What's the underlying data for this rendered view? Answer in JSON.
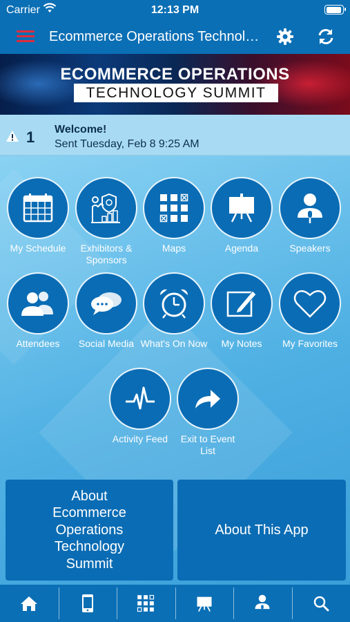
{
  "status_bar": {
    "carrier": "Carrier",
    "time": "12:13 PM"
  },
  "nav": {
    "title": "Ecommerce Operations Technolo…"
  },
  "banner": {
    "line1": "ECOMMERCE OPERATIONS",
    "line2": "TECHNOLOGY SUMMIT"
  },
  "alert": {
    "count": "1",
    "title": "Welcome!",
    "subtitle": "Sent Tuesday, Feb 8 9:25 AM"
  },
  "tiles": [
    {
      "label": "My Schedule",
      "icon": "calendar-icon"
    },
    {
      "label": "Exhibitors & Sponsors",
      "icon": "exhibitor-icon"
    },
    {
      "label": "Maps",
      "icon": "map-grid-icon"
    },
    {
      "label": "Agenda",
      "icon": "easel-icon"
    },
    {
      "label": "Speakers",
      "icon": "speaker-icon"
    },
    {
      "label": "Attendees",
      "icon": "attendees-icon"
    },
    {
      "label": "Social Media",
      "icon": "chat-bubbles-icon"
    },
    {
      "label": "What's On Now",
      "icon": "alarm-clock-icon"
    },
    {
      "label": "My Notes",
      "icon": "notes-pencil-icon"
    },
    {
      "label": "My Favorites",
      "icon": "heart-icon"
    },
    {
      "label": "Activity Feed",
      "icon": "pulse-icon"
    },
    {
      "label": "Exit to Event List",
      "icon": "share-arrow-icon"
    }
  ],
  "about": {
    "event_label": "About Ecommerce Operations Technology Summit",
    "app_label": "About This App"
  },
  "tabbar": [
    "home-icon",
    "mobile-device-icon",
    "map-grid-icon",
    "easel-icon",
    "speaker-icon",
    "search-icon"
  ],
  "colors": {
    "primary": "#0a6fb5",
    "menu_accent": "#e02d3c"
  }
}
